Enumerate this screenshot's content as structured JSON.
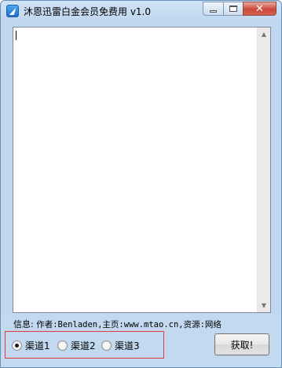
{
  "window": {
    "title": "沐恩迅雷白金会员免费用 v1.0"
  },
  "caption": {
    "minimize_icon": "minimize-icon",
    "maximize_icon": "maximize-icon",
    "close_icon": "close-icon",
    "close_glyph": "✕"
  },
  "textarea": {
    "value": ""
  },
  "info": {
    "label": "信息:",
    "text": "作者:Benladen,主页:www.mtao.cn,资源:网络"
  },
  "channels": [
    {
      "label": "渠道1",
      "checked": true
    },
    {
      "label": "渠道2",
      "checked": false
    },
    {
      "label": "渠道3",
      "checked": false
    }
  ],
  "fetch_button": {
    "label": "获取!"
  },
  "colors": {
    "highlight_border": "#e03a3a",
    "titlebar": "#c2d9f0",
    "close_button": "#c9493a"
  }
}
